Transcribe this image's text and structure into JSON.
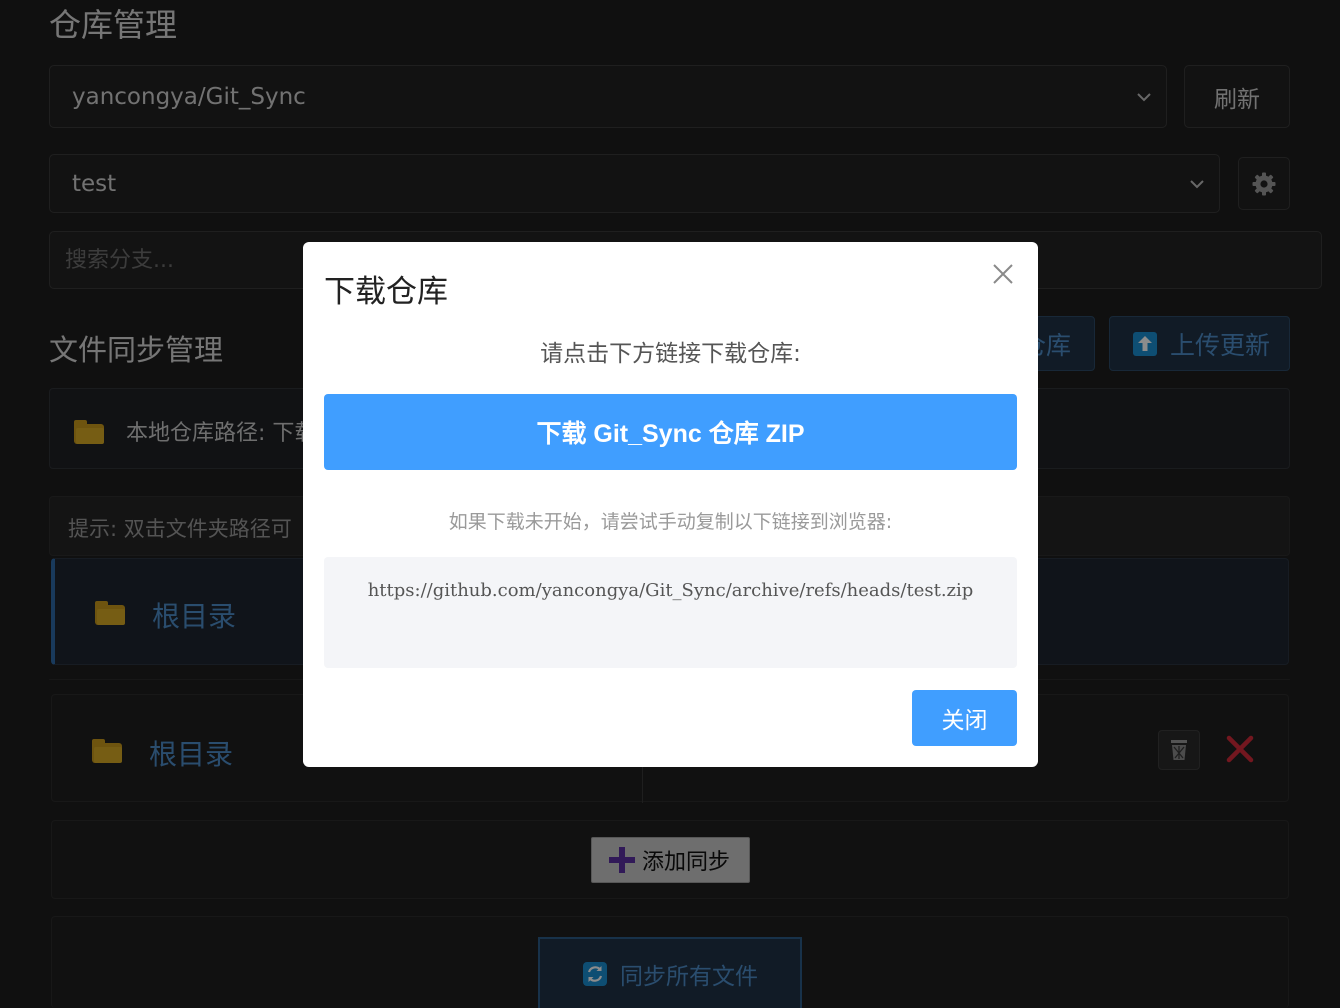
{
  "colors": {
    "accent": "#409eff",
    "dark_bg": "#1e1e1e",
    "link_blue": "#4d8cc9",
    "folder_yellow": "#d7a926",
    "danger_red": "#d12b3a"
  },
  "repo_section": {
    "title": "仓库管理",
    "repo_select_value": "yancongya/Git_Sync",
    "refresh_label": "刷新",
    "branch_select_value": "test",
    "branch_search_placeholder": "搜索分支..."
  },
  "sync_section": {
    "title": "文件同步管理",
    "download_repo_label": "仓库",
    "upload_update_label": "上传更新",
    "local_path_label": "本地仓库路径: 下载",
    "tip_text": "提示: 双击文件夹路径可",
    "root_dir_selected": "根目录",
    "root_dir_row": "根目录",
    "add_sync_label": "添加同步",
    "sync_all_label": "同步所有文件"
  },
  "modal": {
    "title": "下载仓库",
    "prompt": "请点击下方链接下载仓库:",
    "download_button": "下载 Git_Sync 仓库 ZIP",
    "hint": "如果下载未开始，请尝试手动复制以下链接到浏览器:",
    "url": "https://github.com/yancongya/Git_Sync/archive/refs/heads/test.zip",
    "close_button": "关闭"
  }
}
